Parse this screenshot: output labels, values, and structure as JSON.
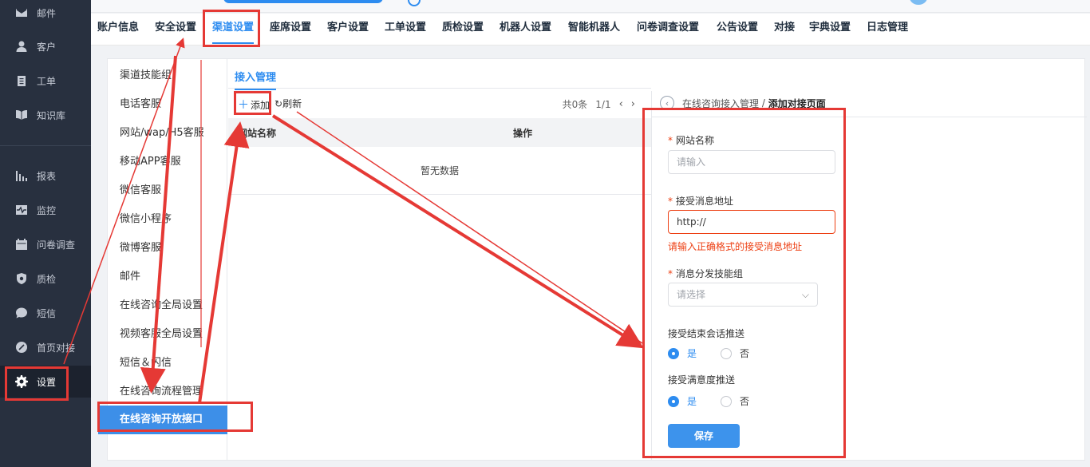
{
  "sidebar": {
    "items": [
      {
        "label": "邮件",
        "icon": "mail-icon"
      },
      {
        "label": "客户",
        "icon": "user-icon"
      },
      {
        "label": "工单",
        "icon": "clipboard-icon"
      },
      {
        "label": "知识库",
        "icon": "book-icon"
      },
      {
        "label": "报表",
        "icon": "bar-chart-icon"
      },
      {
        "label": "监控",
        "icon": "pulse-icon"
      },
      {
        "label": "问卷调查",
        "icon": "calendar-icon"
      },
      {
        "label": "质检",
        "icon": "shield-icon"
      },
      {
        "label": "短信",
        "icon": "chat-icon"
      },
      {
        "label": "首页对接",
        "icon": "link-icon"
      },
      {
        "label": "设置",
        "icon": "gear-icon"
      }
    ]
  },
  "tabs": [
    "账户信息",
    "安全设置",
    "渠道设置",
    "座席设置",
    "客户设置",
    "工单设置",
    "质检设置",
    "机器人设置",
    "智能机器人",
    "问卷调查设置",
    "公告设置",
    "对接",
    "宇典设置",
    "日志管理"
  ],
  "left_menu": [
    "渠道技能组",
    "电话客服",
    "网站/wap/H5客服",
    "移动APP客服",
    "微信客服",
    "微信小程序",
    "微博客服",
    "邮件",
    "在线咨询全局设置",
    "视频客服全局设置",
    "短信＆闪信",
    "在线咨询流程管理",
    "在线咨询开放接口"
  ],
  "center": {
    "subtab": "接入管理",
    "add_label": "添加",
    "refresh_label": "刷新",
    "total": "共0条",
    "page": "1/1",
    "col_site": "网站名称",
    "col_action": "操作",
    "empty": "暂无数据"
  },
  "right": {
    "crumb_parent": "在线咨询接入管理",
    "crumb_sep": " / ",
    "crumb_current": "添加对接页面",
    "site_name_label": "网站名称",
    "site_name_placeholder": "请输入",
    "msg_url_label": "接受消息地址",
    "msg_url_value": "http://",
    "msg_url_error": "请输入正确格式的接受消息地址",
    "skill_group_label": "消息分发技能组",
    "skill_group_placeholder": "请选择",
    "end_push_label": "接受结束会话推送",
    "satisfaction_push_label": "接受满意度推送",
    "yes": "是",
    "no": "否",
    "save_label": "保存"
  },
  "colors": {
    "accent": "#2d8cf0",
    "annotation": "#e53935",
    "sidebar": "#28303f"
  }
}
